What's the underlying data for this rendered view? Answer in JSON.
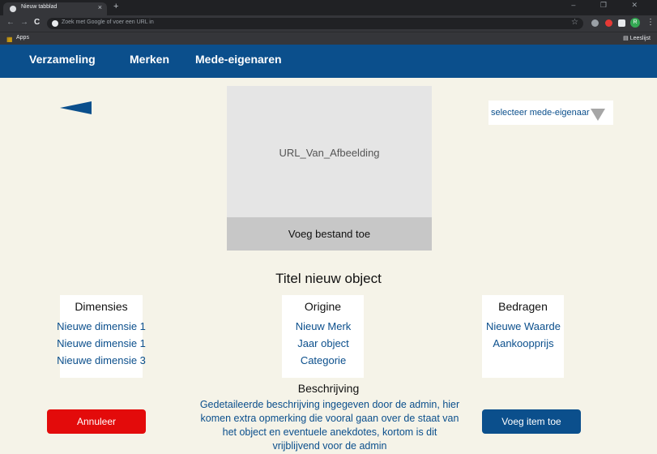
{
  "browser": {
    "tab_title": "Nieuw tabblad",
    "tab_close": "×",
    "new_tab": "+",
    "window_controls": "– ❐ ✕",
    "back": "←",
    "forward": "→",
    "reload": "C",
    "omnibox_placeholder": "Zoek met Google of voer een URL in",
    "star": "☆",
    "profile_initial": "R",
    "menu": "⋮",
    "apps_label": "Apps",
    "reading_list": "Leeslijst"
  },
  "nav": {
    "items": [
      "Verzameling",
      "Merken",
      "Mede-eigenaren"
    ]
  },
  "image": {
    "url_placeholder": "URL_Van_Afbeelding",
    "add_file": "Voeg bestand toe"
  },
  "owner_select": {
    "label": "selecteer mede-eigenaar"
  },
  "object": {
    "title": "Titel nieuw object",
    "columns": [
      {
        "heading": "Dimensies",
        "items": [
          "Nieuwe dimensie 1",
          "Nieuwe dimensie 1",
          "Nieuwe dimensie 3"
        ]
      },
      {
        "heading": "Origine",
        "items": [
          "Nieuw Merk",
          "Jaar object",
          "Categorie"
        ]
      },
      {
        "heading": "Bedragen",
        "items": [
          "Nieuwe Waarde",
          "Aankoopprijs"
        ]
      }
    ],
    "description_heading": "Beschrijving",
    "description": "Gedetaileerde beschrijving ingegeven door de admin, hier komen extra opmerking die vooral gaan over de staat van het object en eventuele anekdotes, kortom is dit vrijblijvend voor de admin"
  },
  "actions": {
    "cancel": "Annuleer",
    "add": "Voeg item toe"
  },
  "colors": {
    "brand_blue": "#0b4f8c",
    "cancel_red": "#e30b0b",
    "background": "#f5f3e8"
  }
}
